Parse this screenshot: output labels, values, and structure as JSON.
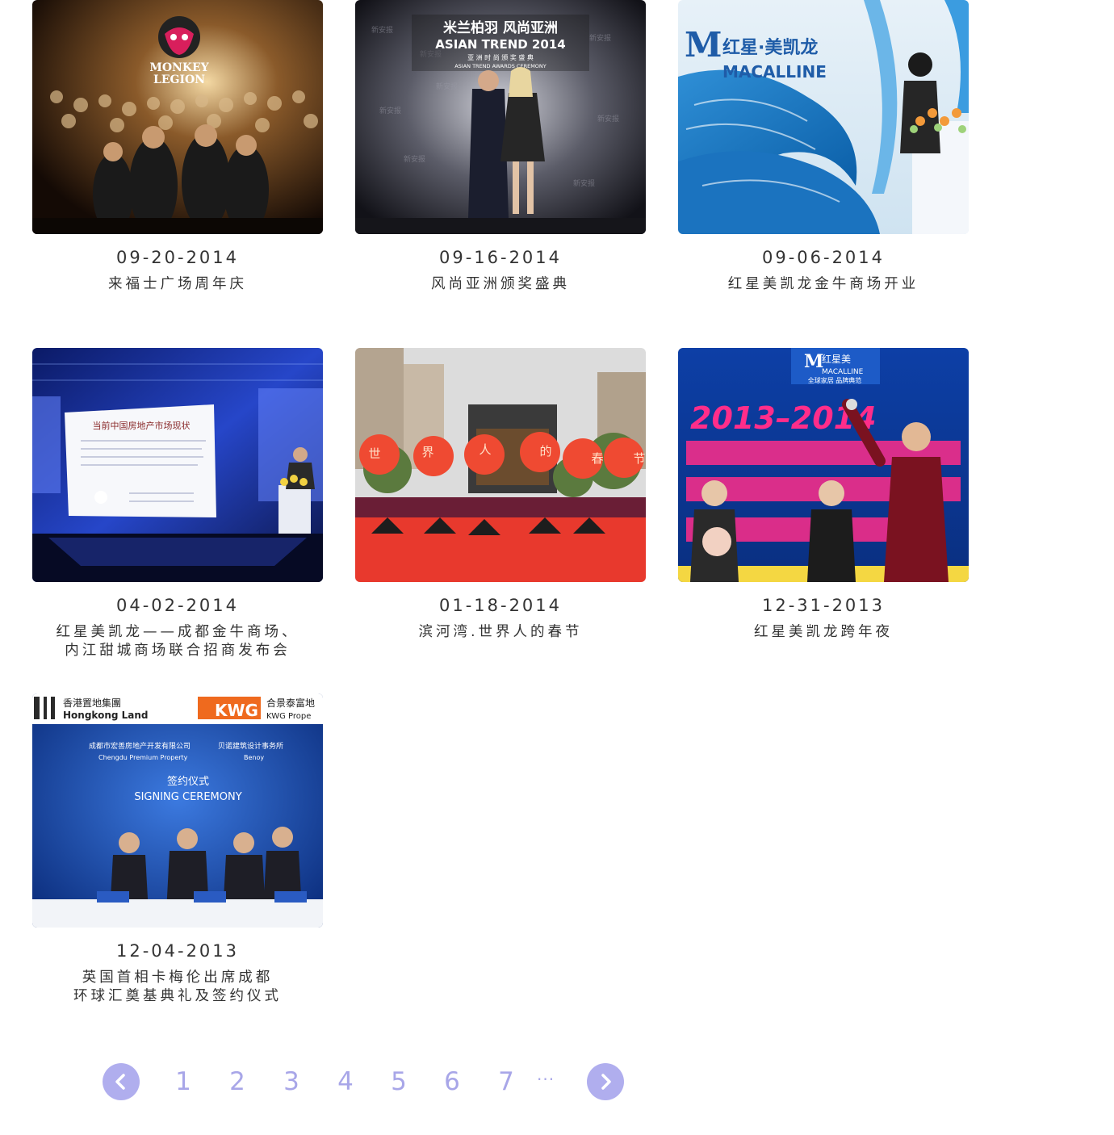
{
  "events": [
    {
      "date": "09-20-2014",
      "title_lines": [
        "来福士广场周年庆"
      ],
      "image_text": [
        "MONKEY",
        "LEGION"
      ]
    },
    {
      "date": "09-16-2014",
      "title_lines": [
        "风尚亚洲颁奖盛典"
      ],
      "image_text": [
        "米兰柏羽 风尚亚洲",
        "ASIAN TREND 2014",
        "亚 洲 时 尚 颁 奖 盛 典",
        "ASIAN TREND AWARDS CEREMONY"
      ]
    },
    {
      "date": "09-06-2014",
      "title_lines": [
        "红星美凯龙金牛商场开业"
      ],
      "image_text": [
        "红星·美凯龙",
        "MACALLINE"
      ]
    },
    {
      "date": "04-02-2014",
      "title_lines": [
        "红星美凯龙——成都金牛商场、",
        "内江甜城商场联合招商发布会"
      ],
      "image_text": [
        "当前中国房地产市场现状"
      ]
    },
    {
      "date": "01-18-2014",
      "title_lines": [
        "滨河湾.世界人的春节"
      ],
      "image_text": [
        "世",
        "界",
        "人",
        "的",
        "春",
        "节"
      ]
    },
    {
      "date": "12-31-2013",
      "title_lines": [
        "红星美凯龙跨年夜"
      ],
      "image_text": [
        "红星美",
        "MACALLINE",
        "全球家居 品牌典范",
        "2013–2014"
      ]
    },
    {
      "date": "12-04-2013",
      "title_lines": [
        "英国首相卡梅伦出席成都",
        "环球汇奠基典礼及签约仪式"
      ],
      "image_text": [
        "香港置地集團",
        "Hongkong Land",
        "KWG",
        "合景泰富地",
        "KWG Prope",
        "成都市宏善房地产开发有限公司",
        "Chengdu Premium Property",
        "贝诺建筑设计事务所",
        "Benoy",
        "签约仪式",
        "SIGNING CEREMONY"
      ]
    }
  ],
  "pagination": {
    "pages": [
      "1",
      "2",
      "3",
      "4",
      "5",
      "6",
      "7"
    ],
    "ellipsis": "···",
    "prev_icon": "chevron-left-icon",
    "next_icon": "chevron-right-icon",
    "accent_color": "#b0aeee"
  }
}
